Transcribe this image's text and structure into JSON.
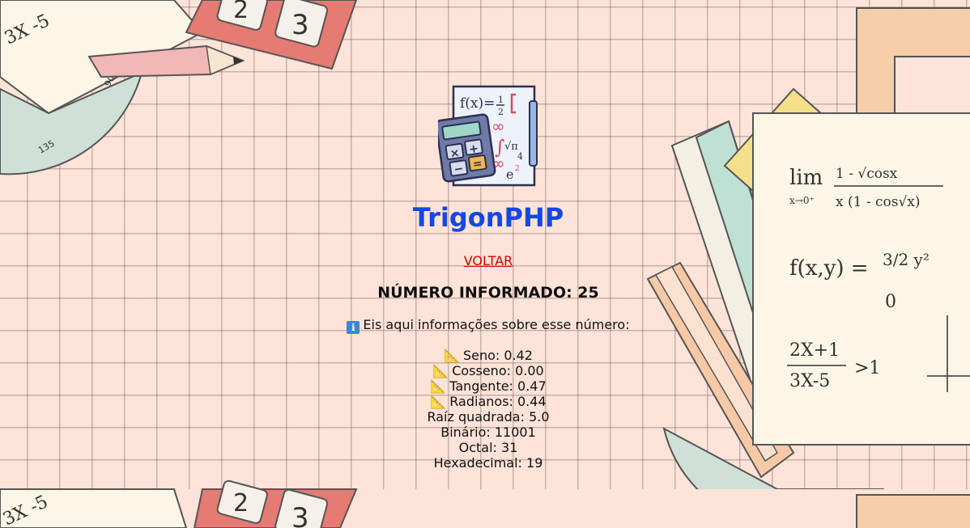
{
  "app": {
    "title": "TrigonPHP",
    "back_link": "VOLTAR"
  },
  "number": {
    "heading": "NÚMERO INFORMADO: 25"
  },
  "info": {
    "text": "Eis aqui informações sobre esse número:",
    "icon": "information-icon"
  },
  "results": {
    "seno": "Seno: 0.42",
    "cosseno": "Cosseno: 0.00",
    "tangente": "Tangente: 0.47",
    "radianos": "Radianos: 0.44",
    "raiz": "Raíz quadrada: 5.0",
    "binario": "Binário: 11001",
    "octal": "Octal: 31",
    "hexadecimal": "Hexadecimal: 19"
  },
  "background_decor": {
    "formula_limit": "lim",
    "formula_limit_sub": "x→0⁺",
    "formula_limit_num": "1 - √cosx",
    "formula_limit_den": "x (1 - cos√x)",
    "formula_f": "f(x,y) =",
    "formula_piece_top": "3/2 y²",
    "formula_piece_bottom": "0",
    "formula_ineq_num": "2X+1",
    "formula_ineq_den": "3X-5",
    "formula_ineq_rhs": ">1",
    "formula_corner": "3X -5",
    "tile_2": "2",
    "tile_3": "3"
  },
  "colors": {
    "title": "#1447e6",
    "link": "#d90000",
    "background": "#fde3d8"
  }
}
